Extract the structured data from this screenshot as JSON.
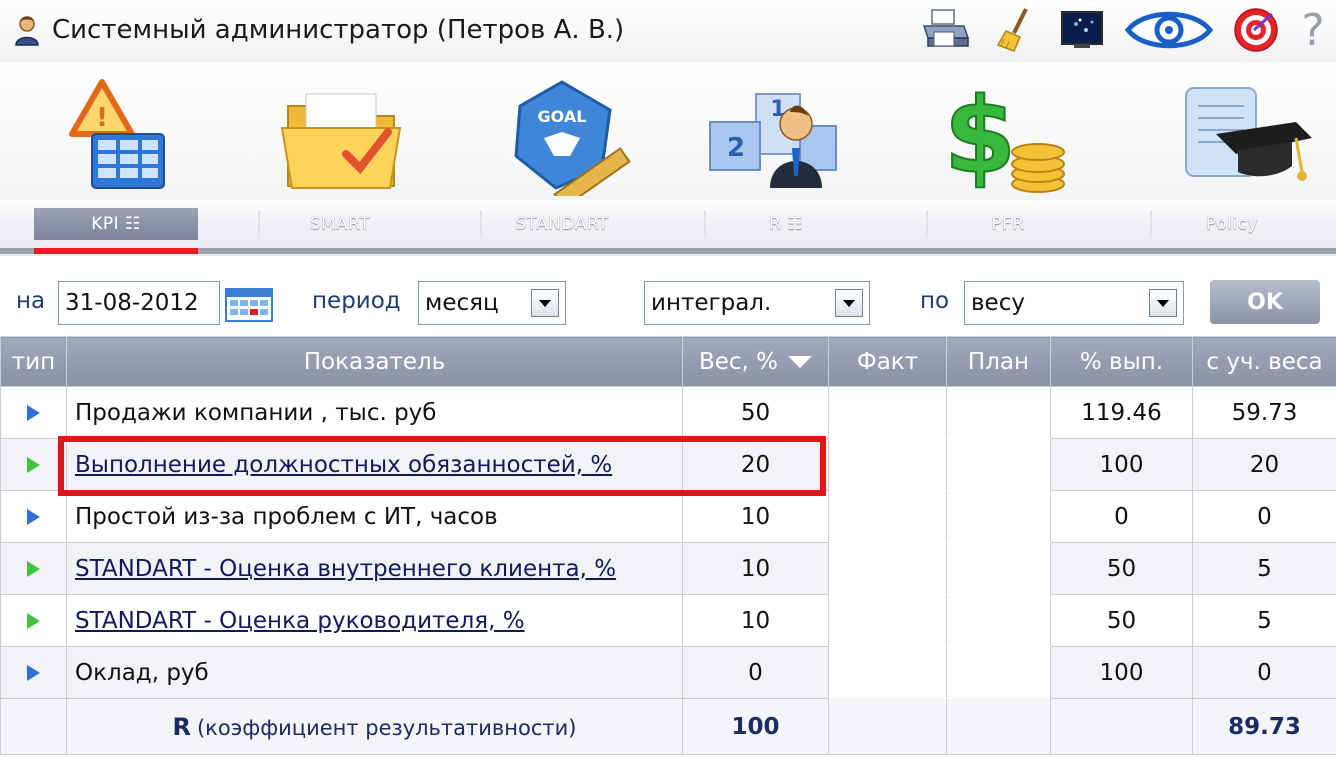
{
  "header": {
    "user_label": "Системный администратор  (Петров А. В.)",
    "user_icon": "user-icon",
    "tools": [
      "print-icon",
      "broom-icon",
      "screen-icon",
      "eye-icon",
      "target-icon",
      "help-icon"
    ],
    "help_glyph": "?"
  },
  "modules": [
    {
      "icon": "kpi-table-icon",
      "tab": "KPI  ☷"
    },
    {
      "icon": "folder-check-icon",
      "tab": "SMART"
    },
    {
      "icon": "goal-ruler-icon",
      "tab": "STANDART"
    },
    {
      "icon": "podium-person-icon",
      "tab": "R  ☷"
    },
    {
      "icon": "dollar-coins-icon",
      "tab": "PFR"
    },
    {
      "icon": "diploma-cap-icon",
      "tab": "Policy"
    }
  ],
  "active_tab": "KPI",
  "filters": {
    "on_label": "на",
    "date": "31-08-2012",
    "period_label": "период",
    "period_value": "месяц",
    "mode_value": "интеграл.",
    "by_label": "по",
    "by_value": "весу",
    "ok_label": "OK"
  },
  "table": {
    "columns": [
      "тип",
      "Показатель",
      "Вес, %",
      "Факт",
      "План",
      "% вып.",
      "с уч. веса"
    ],
    "rows": [
      {
        "type": "blue",
        "name": "Продажи компании , тыс. руб",
        "link": false,
        "weight": "50",
        "fact": "",
        "plan": "",
        "pct": "119.46",
        "weighted": "59.73"
      },
      {
        "type": "green",
        "name": "Выполнение должностных обязанностей, %",
        "link": true,
        "weight": "20",
        "fact": "",
        "plan": "",
        "pct": "100",
        "weighted": "20"
      },
      {
        "type": "blue",
        "name": "Простой из-за проблем с ИТ, часов",
        "link": false,
        "weight": "10",
        "fact": "",
        "plan": "",
        "pct": "0",
        "weighted": "0"
      },
      {
        "type": "green",
        "name": "STANDART - Оценка внутреннего клиента, %",
        "link": true,
        "weight": "10",
        "fact": "",
        "plan": "",
        "pct": "50",
        "weighted": "5"
      },
      {
        "type": "green",
        "name": "STANDART - Оценка руководителя, %",
        "link": true,
        "weight": "10",
        "fact": "",
        "plan": "",
        "pct": "50",
        "weighted": "5"
      },
      {
        "type": "blue",
        "name": "Оклад, руб",
        "link": false,
        "weight": "0",
        "fact": "",
        "plan": "",
        "pct": "100",
        "weighted": "0"
      }
    ],
    "total": {
      "r_letter": "R",
      "label": "(коэффициент результативности)",
      "weight": "100",
      "weighted": "89.73"
    }
  },
  "colors": {
    "accent_red": "#e31b22",
    "header_gray": "#8a92a6",
    "link_navy": "#10195e",
    "arrow_blue": "#2c6fd6",
    "arrow_green": "#3fc53a"
  }
}
